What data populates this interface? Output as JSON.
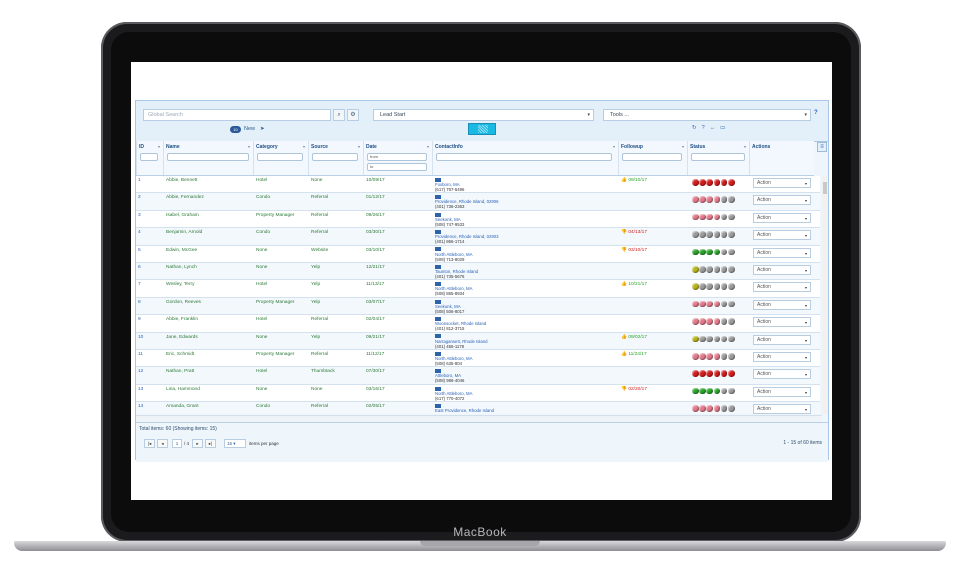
{
  "device": {
    "brand": "MacBook"
  },
  "toolbar": {
    "search_placeholder": "Global Search",
    "view_select": "Lead Start",
    "tools_select": "Tools ...",
    "help": "?",
    "new_count": "10",
    "new_label": "New"
  },
  "columns": [
    {
      "key": "id",
      "label": "ID"
    },
    {
      "key": "name",
      "label": "Name"
    },
    {
      "key": "category",
      "label": "Category"
    },
    {
      "key": "source",
      "label": "Source"
    },
    {
      "key": "date",
      "label": "Date"
    },
    {
      "key": "contact",
      "label": "ContactInfo"
    },
    {
      "key": "followup",
      "label": "Followup"
    },
    {
      "key": "status",
      "label": "Status"
    },
    {
      "key": "actions",
      "label": "Actions"
    }
  ],
  "date_filter": {
    "from": "from",
    "to": "to"
  },
  "colors": {
    "red": "#d11d1d",
    "pink": "#e07a8a",
    "gray": "#9a9a9a",
    "green": "#2aa32a",
    "olive": "#b5b21e"
  },
  "rows": [
    {
      "id": "1",
      "name": "Abbie, Bennett",
      "category": "Hotel",
      "source": "None",
      "date": "10/09/17",
      "contact": "Foxboro, MA",
      "phone": "(617) 757-5496",
      "followup": "09/10/17",
      "fu_type": "up",
      "status": [
        "red",
        "red",
        "red",
        "red",
        "red",
        "red"
      ],
      "action": "Action"
    },
    {
      "id": "2",
      "name": "Abbie, Fernandez",
      "category": "Condo",
      "source": "Referral",
      "date": "01/12/17",
      "contact": "Providence, Rhode Island, 02906",
      "phone": "(401) 736-2363",
      "followup": "",
      "fu_type": "",
      "status": [
        "pink",
        "pink",
        "pink",
        "pink",
        "gray",
        "gray"
      ],
      "action": "Action"
    },
    {
      "id": "3",
      "name": "Isabel, Graham",
      "category": "Property Manager",
      "source": "Referral",
      "date": "09/26/17",
      "contact": "Seekonk, MA",
      "phone": "(508) 747-9533",
      "followup": "",
      "fu_type": "",
      "status": [
        "pink",
        "pink",
        "pink",
        "pink",
        "gray",
        "gray"
      ],
      "action": "Action"
    },
    {
      "id": "4",
      "name": "Benjamin, Arnold",
      "category": "Condo",
      "source": "Referral",
      "date": "03/30/17",
      "contact": "Providence, Rhode Island, 02903",
      "phone": "(401) 866-1714",
      "followup": "04/13/17",
      "fu_type": "down",
      "status": [
        "gray",
        "gray",
        "gray",
        "gray",
        "gray",
        "gray"
      ],
      "action": "Action"
    },
    {
      "id": "5",
      "name": "Edwin, McGee",
      "category": "None",
      "source": "Website",
      "date": "03/10/17",
      "contact": "North Attleboro, MA",
      "phone": "(508) 713-8029",
      "followup": "03/10/17",
      "fu_type": "down",
      "status": [
        "green",
        "green",
        "green",
        "green",
        "gray",
        "gray"
      ],
      "action": "Action"
    },
    {
      "id": "6",
      "name": "Nathan, Lynch",
      "category": "None",
      "source": "Yelp",
      "date": "12/21/17",
      "contact": "Taunton, Rhode Island",
      "phone": "(401) 735-5676",
      "followup": "",
      "fu_type": "",
      "status": [
        "olive",
        "gray",
        "gray",
        "gray",
        "gray",
        "gray"
      ],
      "action": "Action"
    },
    {
      "id": "7",
      "name": "Wesley, Terry",
      "category": "Hotel",
      "source": "Yelp",
      "date": "11/13/17",
      "contact": "North Attleboro, MA",
      "phone": "(508) 865-8934",
      "followup": "10/21/17",
      "fu_type": "up",
      "status": [
        "olive",
        "gray",
        "gray",
        "gray",
        "gray",
        "gray"
      ],
      "action": "Action"
    },
    {
      "id": "8",
      "name": "Gordon, Reeves",
      "category": "Property Manager",
      "source": "Yelp",
      "date": "03/07/17",
      "contact": "Seekonk, MA",
      "phone": "(508) 506-8017",
      "followup": "",
      "fu_type": "",
      "status": [
        "pink",
        "pink",
        "pink",
        "pink",
        "gray",
        "gray"
      ],
      "action": "Action"
    },
    {
      "id": "9",
      "name": "Abbie, Franklin",
      "category": "Hotel",
      "source": "Referral",
      "date": "02/04/17",
      "contact": "Woonsocket, Rhode Island",
      "phone": "(401) 812-3715",
      "followup": "",
      "fu_type": "",
      "status": [
        "pink",
        "pink",
        "pink",
        "pink",
        "gray",
        "gray"
      ],
      "action": "Action"
    },
    {
      "id": "10",
      "name": "Jane, Edwards",
      "category": "None",
      "source": "Yelp",
      "date": "09/21/17",
      "contact": "Narragansett, Rhode Island",
      "phone": "(401) 456-1178",
      "followup": "09/02/17",
      "fu_type": "up",
      "status": [
        "olive",
        "gray",
        "gray",
        "gray",
        "gray",
        "gray"
      ],
      "action": "Action"
    },
    {
      "id": "11",
      "name": "Eric, Schmidt",
      "category": "Property Manager",
      "source": "Referral",
      "date": "11/12/17",
      "contact": "North Attleboro, MA",
      "phone": "(508) 635-804",
      "followup": "11/24/17",
      "fu_type": "up",
      "status": [
        "pink",
        "pink",
        "pink",
        "pink",
        "gray",
        "gray"
      ],
      "action": "Action"
    },
    {
      "id": "12",
      "name": "Nathan, Pratt",
      "category": "Hotel",
      "source": "Thumbtack",
      "date": "07/30/17",
      "contact": "Attleboro, MA",
      "phone": "(508) 986-4046",
      "followup": "",
      "fu_type": "",
      "status": [
        "red",
        "red",
        "red",
        "red",
        "red",
        "red"
      ],
      "action": "Action"
    },
    {
      "id": "13",
      "name": "Lina, Hammond",
      "category": "None",
      "source": "None",
      "date": "03/16/17",
      "contact": "North Attleboro, MA",
      "phone": "(617) 770-4072",
      "followup": "02/20/17",
      "fu_type": "down",
      "status": [
        "green",
        "green",
        "green",
        "green",
        "gray",
        "gray"
      ],
      "action": "Action"
    },
    {
      "id": "14",
      "name": "Amanda, Grant",
      "category": "Condo",
      "source": "Referral",
      "date": "02/05/17",
      "contact": "East Providence, Rhode Island",
      "phone": "",
      "followup": "",
      "fu_type": "",
      "status": [
        "pink",
        "pink",
        "pink",
        "pink",
        "gray",
        "gray"
      ],
      "action": "Action"
    }
  ],
  "footer": {
    "total": "Total items: 60 (Showing items: 15)",
    "page": "1",
    "of_pages": "/ 4",
    "per_page": "15",
    "per_page_label": "items per page",
    "range": "1 - 15 of 60 items"
  }
}
